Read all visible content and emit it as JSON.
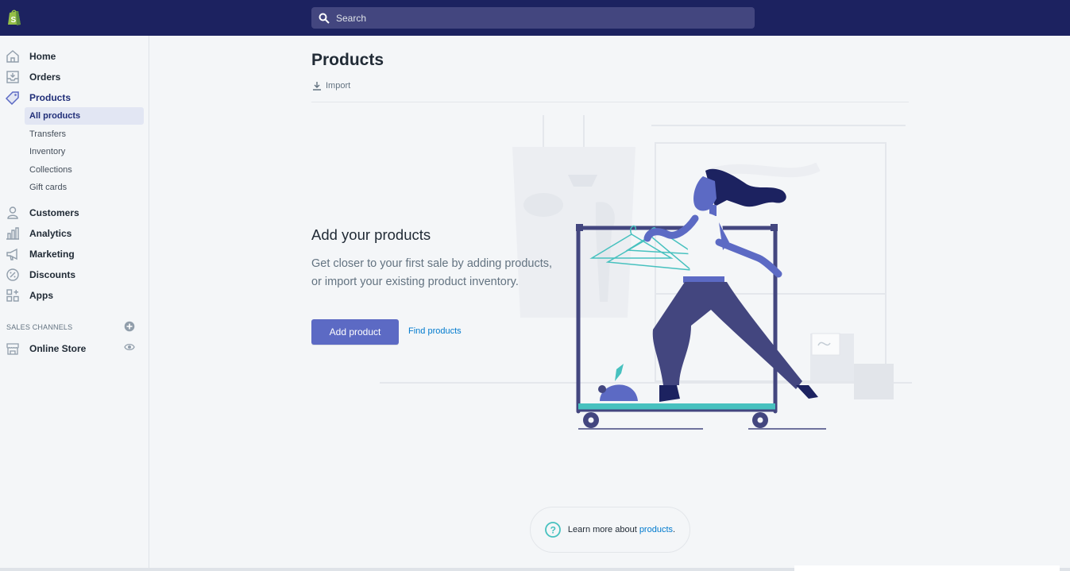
{
  "topbar": {
    "logo": "shopify-bag-logo",
    "search_placeholder": "Search",
    "bg_color": "#1c2260"
  },
  "sidebar": {
    "items": [
      {
        "label": "Home",
        "icon": "home-icon"
      },
      {
        "label": "Orders",
        "icon": "orders-icon"
      },
      {
        "label": "Products",
        "icon": "tag-icon",
        "active": true
      },
      {
        "label": "Customers",
        "icon": "person-icon"
      },
      {
        "label": "Analytics",
        "icon": "bar-chart-icon"
      },
      {
        "label": "Marketing",
        "icon": "megaphone-icon"
      },
      {
        "label": "Discounts",
        "icon": "discount-icon"
      },
      {
        "label": "Apps",
        "icon": "apps-icon"
      }
    ],
    "product_subitems": [
      "All products",
      "Transfers",
      "Inventory",
      "Collections",
      "Gift cards"
    ],
    "sales_channels_title": "SALES CHANNELS",
    "online_store_label": "Online Store"
  },
  "main": {
    "title": "Products",
    "import_label": "Import",
    "empty_title": "Add your products",
    "empty_body": "Get closer to your first sale by adding products, or import your existing product inventory.",
    "add_button": "Add product",
    "find_link": "Find products",
    "learn_prefix": "Learn more about ",
    "learn_link": "products",
    "learn_suffix": "."
  },
  "colors": {
    "accent": "#5c6ac4",
    "link": "#007ace",
    "active_nav": "#202e78",
    "active_bg": "#e2e6f3"
  }
}
